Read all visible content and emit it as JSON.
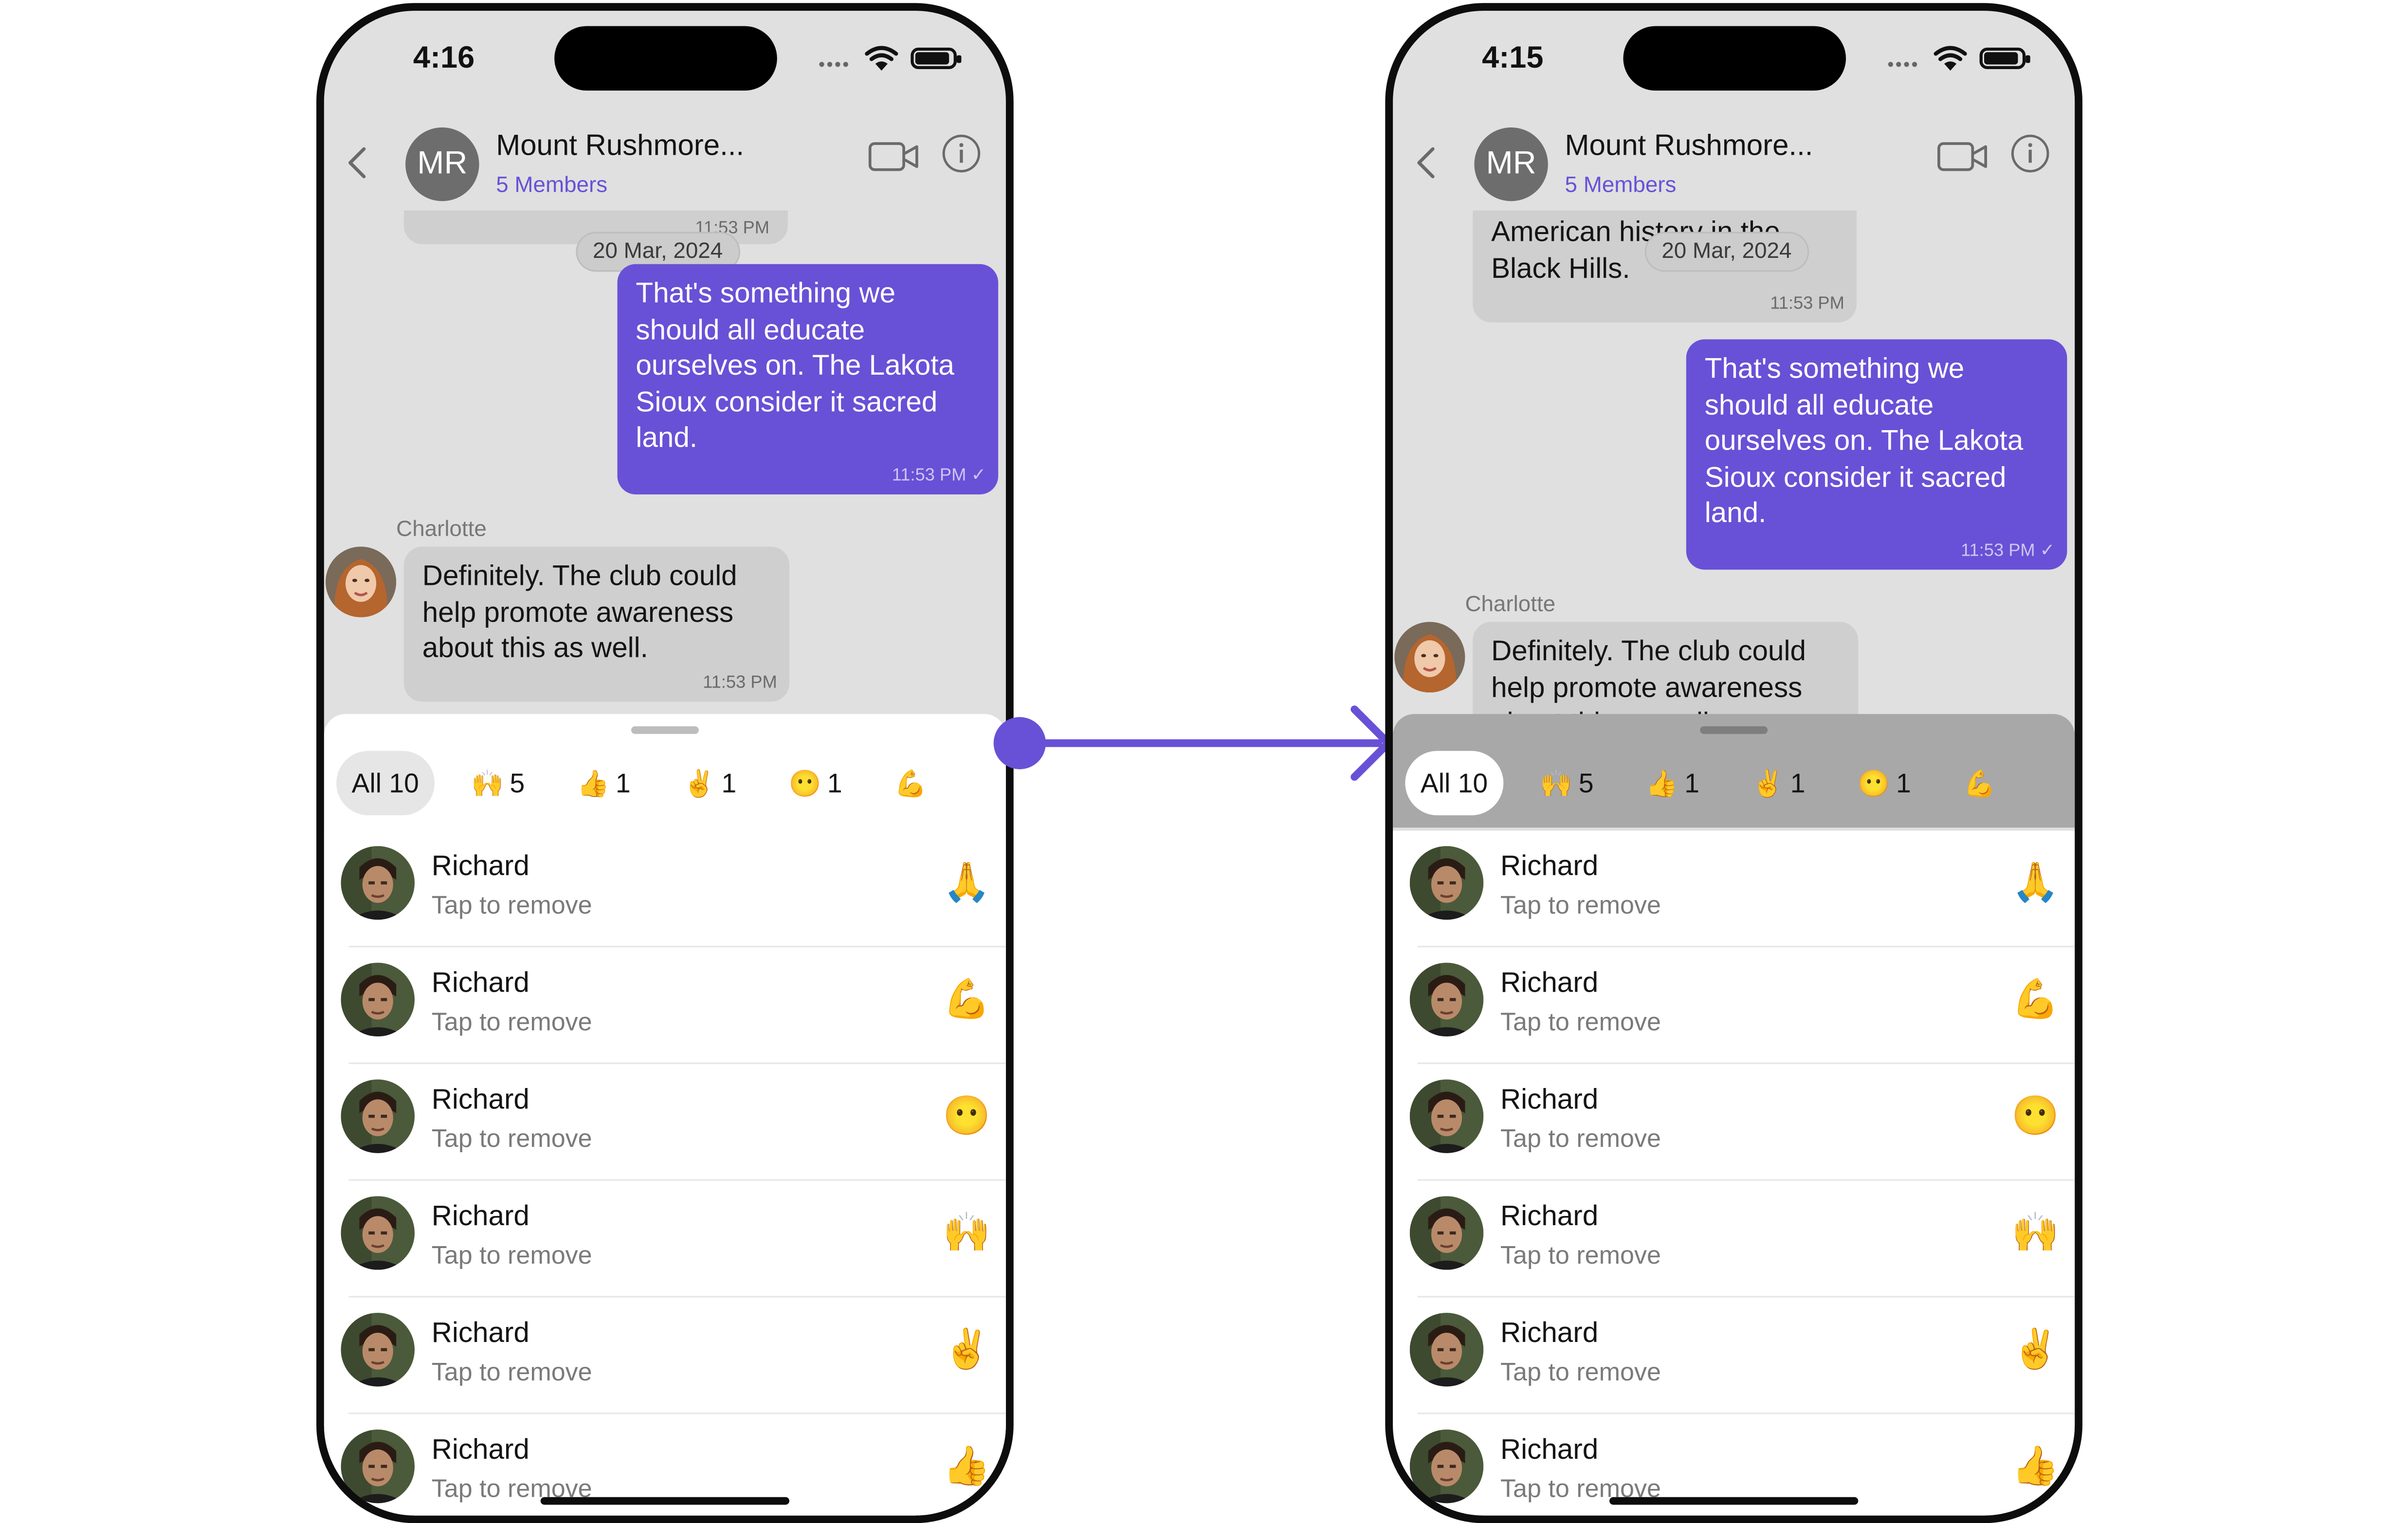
{
  "status_bar": {
    "left_time": "4:16",
    "right_time": "4:15"
  },
  "header": {
    "avatar_initials": "MR",
    "title": "Mount Rushmore...",
    "subtitle": "5 Members"
  },
  "chat": {
    "partial_time_left": "11:53 PM",
    "partial_text_line1": "American history in the",
    "partial_text_line2": "Black Hills.",
    "partial_time_right": "11:53 PM",
    "date_label": "20 Mar, 2024",
    "outgoing": {
      "text": "That's something we should all educate ourselves on. The Lakota Sioux consider it sacred land.",
      "time": "11:53 PM",
      "receipt": "✓"
    },
    "incoming": {
      "sender": "Charlotte",
      "text": "Definitely. The club could help promote awareness about this as well.",
      "time": "11:53 PM"
    }
  },
  "tabs": [
    {
      "emoji": "",
      "label": "All",
      "count": "10"
    },
    {
      "emoji": "🙌",
      "label": "",
      "count": "5"
    },
    {
      "emoji": "👍",
      "label": "",
      "count": "1"
    },
    {
      "emoji": "✌️",
      "label": "",
      "count": "1"
    },
    {
      "emoji": "😶",
      "label": "",
      "count": "1"
    },
    {
      "emoji": "💪",
      "label": "",
      "count": ""
    }
  ],
  "reactions": [
    {
      "name": "Richard",
      "subtitle": "Tap to remove",
      "emoji": "🙏"
    },
    {
      "name": "Richard",
      "subtitle": "Tap to remove",
      "emoji": "💪"
    },
    {
      "name": "Richard",
      "subtitle": "Tap to remove",
      "emoji": "😶"
    },
    {
      "name": "Richard",
      "subtitle": "Tap to remove",
      "emoji": "🙌"
    },
    {
      "name": "Richard",
      "subtitle": "Tap to remove",
      "emoji": "✌️"
    },
    {
      "name": "Richard",
      "subtitle": "Tap to remove",
      "emoji": "👍"
    }
  ],
  "colors": {
    "accent": "#6851d6",
    "chat_bg": "#e0e0e0",
    "incoming_bubble": "#cfcfcf",
    "sheet_bg": "#ffffff",
    "dim_overlay": "#a8a8a8"
  }
}
